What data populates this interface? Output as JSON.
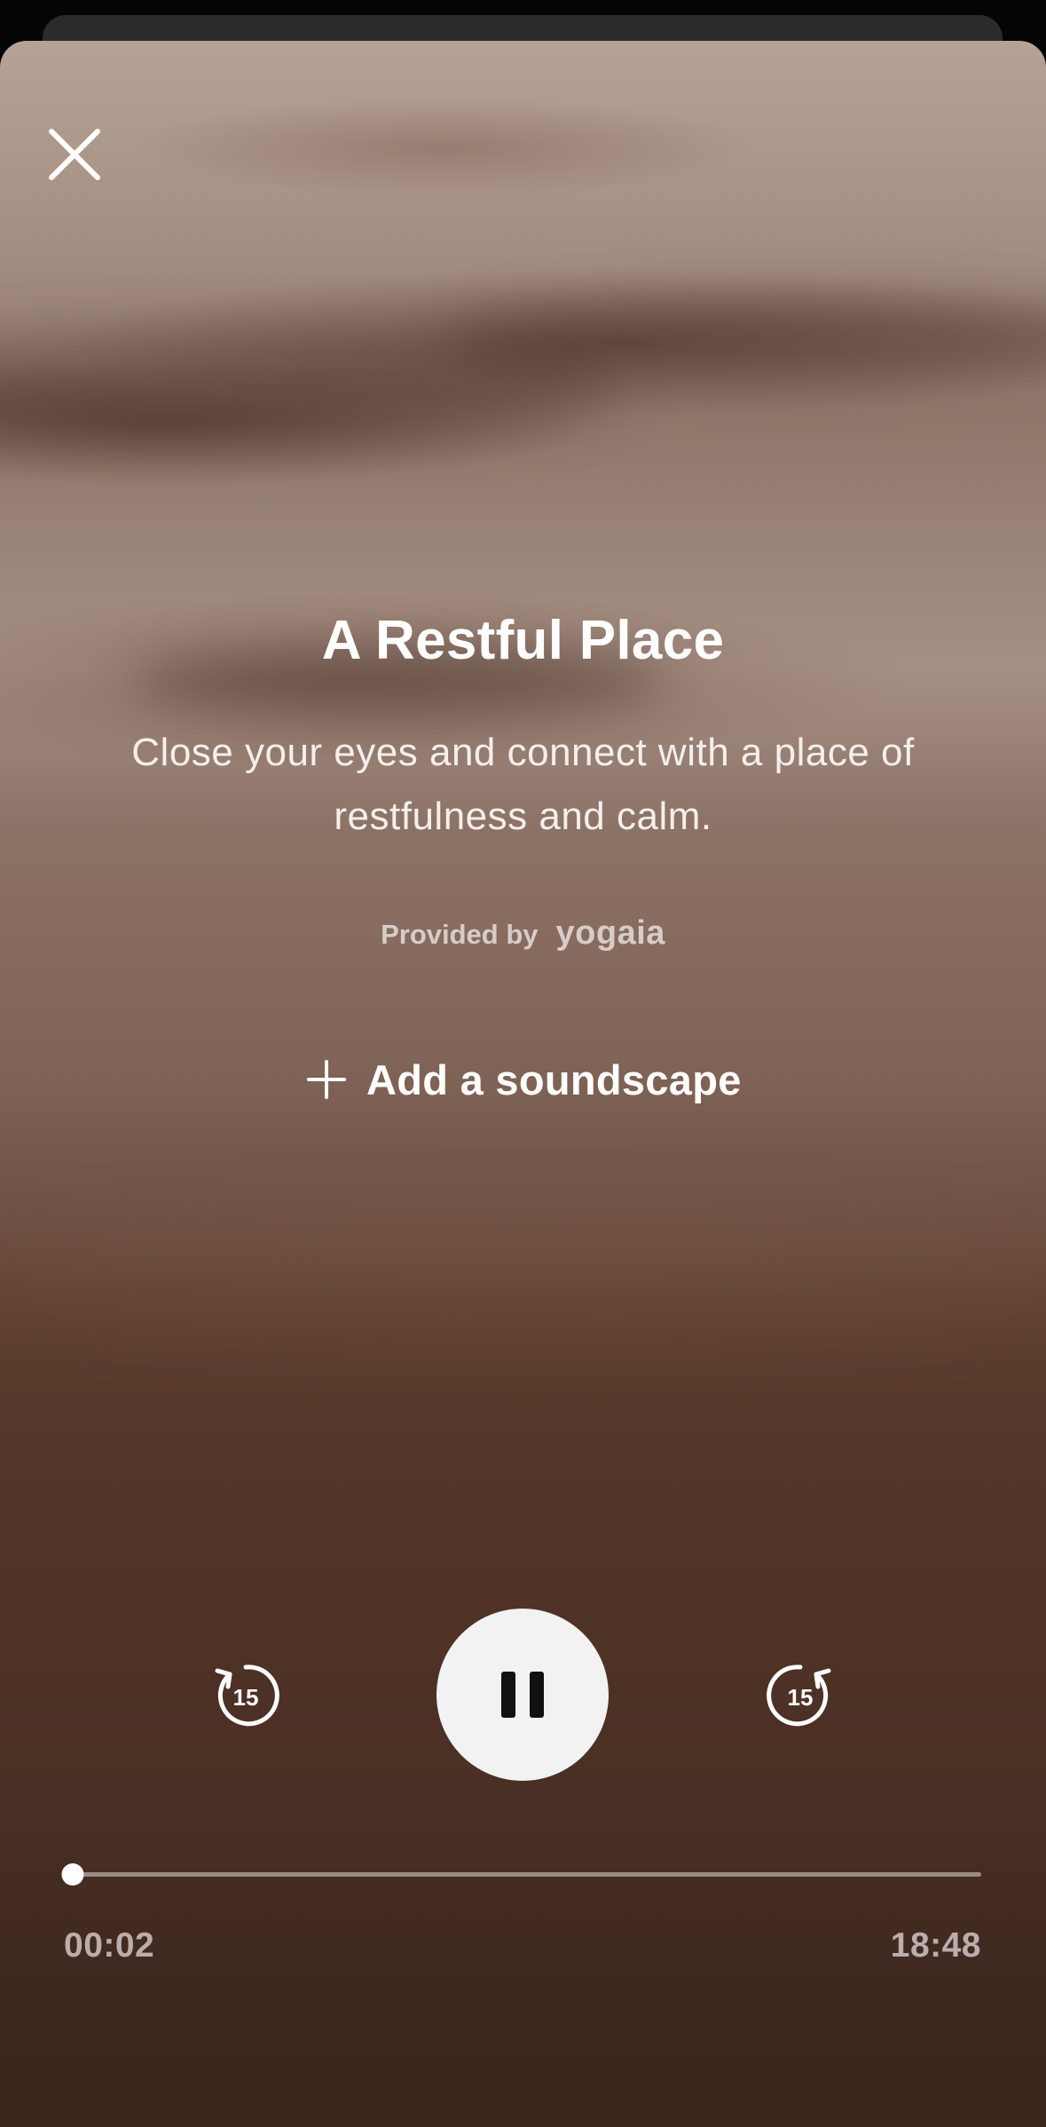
{
  "session": {
    "title": "A Restful Place",
    "description": "Close your eyes and connect with a place of restfulness and calm.",
    "provider_label": "Provided by",
    "provider_name": "yogaia"
  },
  "soundscape": {
    "label": "Add a soundscape"
  },
  "player": {
    "skip_back_seconds": "15",
    "skip_forward_seconds": "15",
    "state": "playing",
    "elapsed": "00:02",
    "total": "18:48",
    "progress_fraction": 0.0018
  },
  "icons": {
    "close": "close-icon",
    "add": "plus-icon",
    "skip_back": "rewind-15-icon",
    "skip_forward": "forward-15-icon",
    "pause": "pause-icon"
  },
  "colors": {
    "play_button_bg": "#f2f2f2",
    "text_primary": "#ffffff"
  }
}
